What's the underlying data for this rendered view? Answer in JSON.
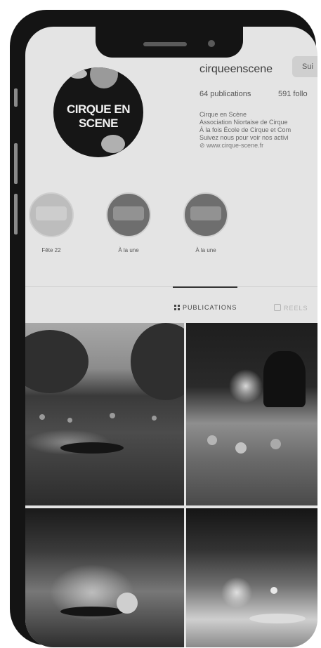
{
  "profile": {
    "username": "cirqueenscene",
    "follow_label": "Sui",
    "logo_text": "CIRQUE EN SCENE",
    "publications": "64 publications",
    "followers": "591 follo",
    "bio_lines": [
      "Cirque en Scène",
      "Association Niortaise de Cirque",
      "À la fois École de Cirque et Com",
      "Suivez nous pour voir nos activi"
    ],
    "link": "www.cirque-scene.fr"
  },
  "highlights": [
    {
      "label": "Fête 22"
    },
    {
      "label": "À la une"
    },
    {
      "label": "À la une"
    }
  ],
  "tabs": {
    "publications": "PUBLICATIONS",
    "reels": "REELS"
  },
  "icons": [
    "link-icon",
    "grid-icon",
    "reels-icon"
  ],
  "colors": {
    "screen_bg": "#e4e4e4",
    "phone_frame": "#141414"
  }
}
